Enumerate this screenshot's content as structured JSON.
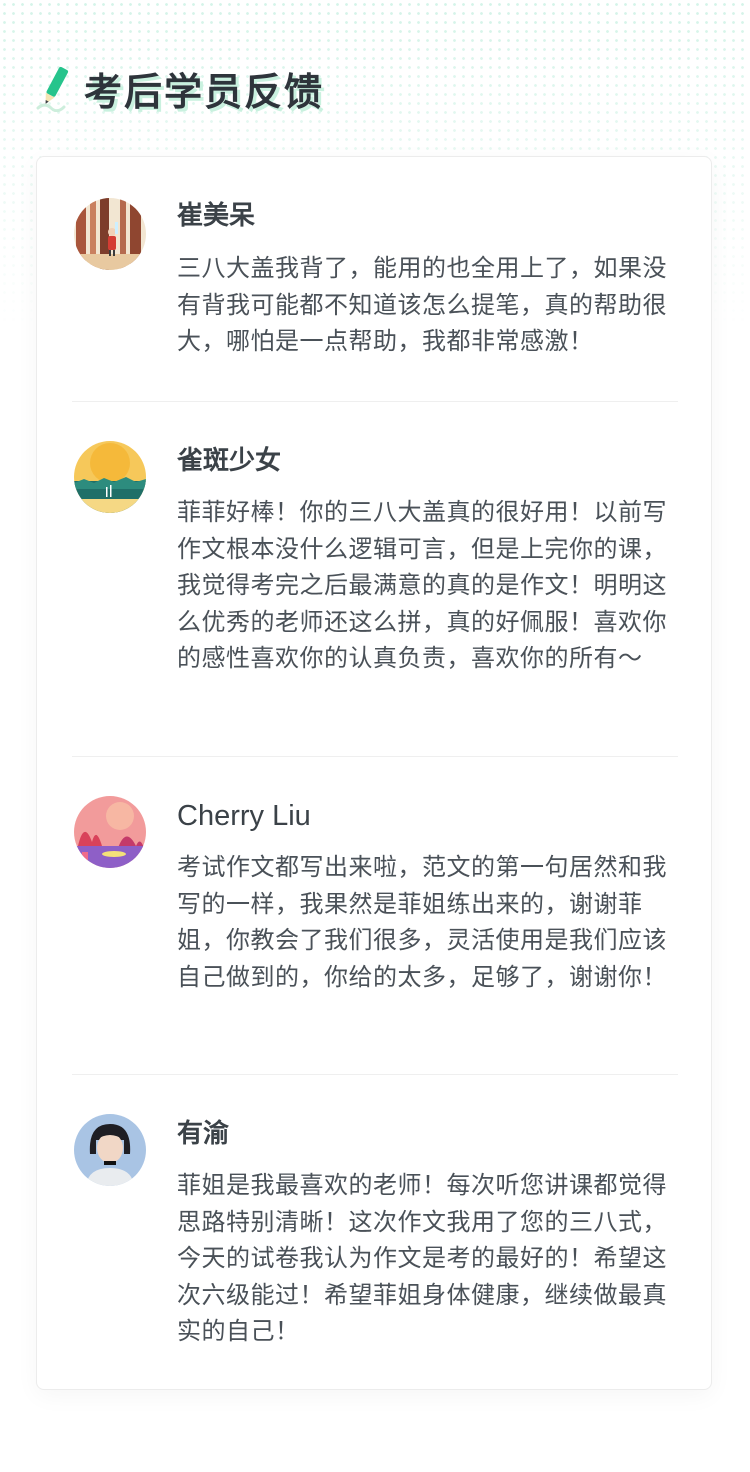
{
  "header": {
    "title": "考后学员反馈",
    "icon": "pencil-icon"
  },
  "reviews": [
    {
      "name": "崔美呆",
      "avatar": "forest-illustration-avatar",
      "text": "三八大盖我背了，能用的也全用上了，如果没有背我可能都不知道该怎么提笔，真的帮助很大，哪怕是一点帮助，我都非常感激！"
    },
    {
      "name": "雀斑少女",
      "avatar": "sunset-landscape-avatar",
      "text": "菲菲好棒！你的三八大盖真的很好用！以前写作文根本没什么逻辑可言，但是上完你的课，我觉得考完之后最满意的真的是作文！明明这么优秀的老师还这么拼，真的好佩服！喜欢你的感性喜欢你的认真负责，喜欢你的所有～"
    },
    {
      "name": "Cherry Liu",
      "avatar": "pink-garden-avatar",
      "text": "考试作文都写出来啦，范文的第一句居然和我写的一样，我果然是菲姐练出来的，谢谢菲姐，你教会了我们很多，灵活使用是我们应该自己做到的，你给的太多，足够了，谢谢你！"
    },
    {
      "name": "有渝",
      "avatar": "girl-portrait-avatar",
      "text": "菲姐是我最喜欢的老师！每次听您讲课都觉得思路特别清晰！这次作文我用了您的三八式，今天的试卷我认为作文是考的最好的！希望这次六级能过！希望菲姐身体健康，继续做最真实的自己！"
    }
  ],
  "colors": {
    "accent": "#26c48c",
    "title": "#2e343b",
    "text": "#4a5158",
    "divider": "#efefef"
  }
}
